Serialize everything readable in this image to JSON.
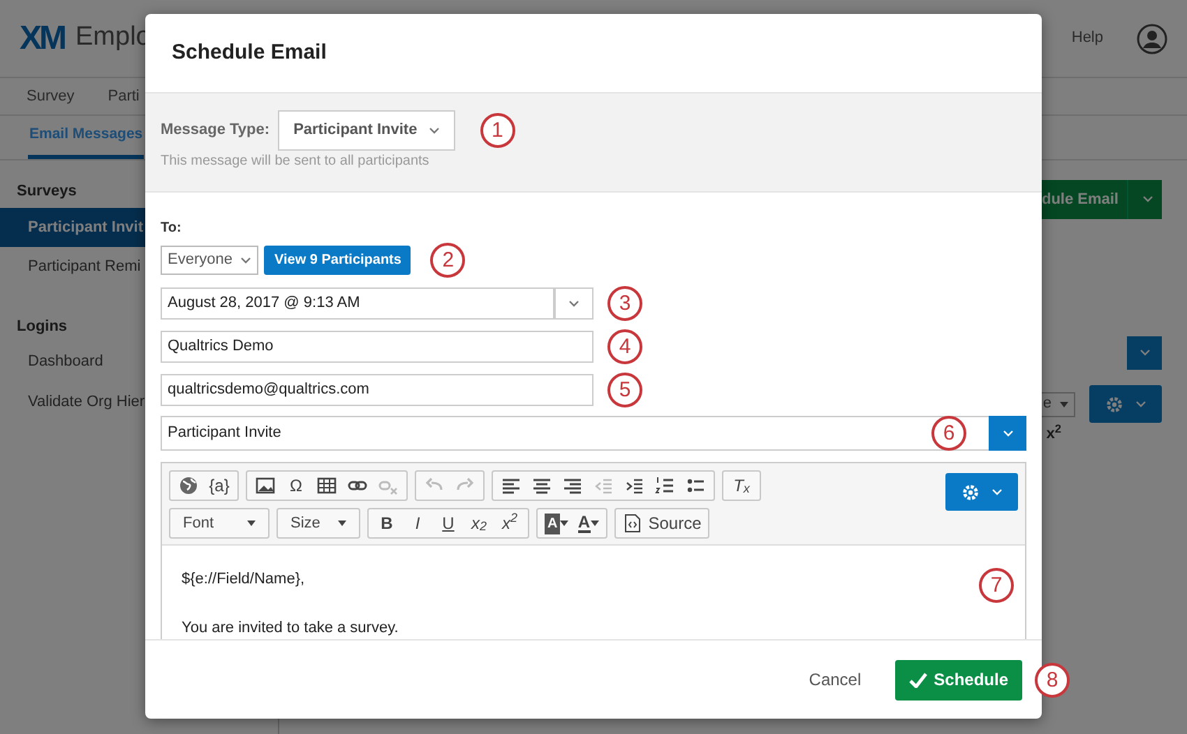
{
  "background": {
    "logo": "XM",
    "app_title": "Emplo",
    "help": "Help",
    "tabs": [
      {
        "label": "Survey",
        "selected": false
      },
      {
        "label": "Parti",
        "selected": false
      }
    ],
    "subtabs": [
      {
        "label": "Email Messages",
        "selected": true
      }
    ],
    "sidebar": [
      {
        "heading": "Surveys",
        "items": [
          {
            "label": "Participant Invit",
            "selected": true
          },
          {
            "label": "Participant Remi",
            "selected": false
          }
        ]
      },
      {
        "heading": "Logins",
        "items": [
          {
            "label": "Dashboard",
            "selected": false
          },
          {
            "label": "Validate Org Hier",
            "selected": false
          }
        ]
      }
    ],
    "schedule_button": "dule Email",
    "small_select": "e",
    "superscript": "x$^{2}$"
  },
  "dialog": {
    "title": "Schedule Email",
    "message_type": {
      "label": "Message Type:",
      "value": "Participant Invite",
      "hint": "This message will be sent to all participants"
    },
    "to": {
      "label": "To:",
      "select": "Everyone",
      "button": "View 9 Participants"
    },
    "send_date": "August 28, 2017 @ 9:13 AM",
    "from_name": "Qualtrics Demo",
    "reply_to": "qualtricsdemo@qualtrics.com",
    "message": "Participant Invite",
    "toolbar": {
      "rows": [
        [
          [
            {
              "kind": "globe"
            },
            {
              "kind": "text",
              "label": "{a}"
            }
          ],
          [
            {
              "kind": "image"
            },
            {
              "kind": "text",
              "label": "Ω"
            },
            {
              "kind": "table"
            },
            {
              "kind": "link"
            },
            {
              "kind": "unlink",
              "disabled": true
            }
          ],
          [
            {
              "kind": "undo",
              "disabled": true
            },
            {
              "kind": "redo",
              "disabled": true
            }
          ],
          [
            {
              "kind": "alignleft"
            },
            {
              "kind": "aligncenter"
            },
            {
              "kind": "alignright"
            },
            {
              "kind": "outdent",
              "disabled": true
            },
            {
              "kind": "indent"
            },
            {
              "kind": "numbered"
            },
            {
              "kind": "bulleted"
            }
          ],
          [
            {
              "kind": "rich",
              "label": "T$_{x}$"
            }
          ]
        ],
        [
          [
            {
              "kind": "dropdown",
              "label": "Font"
            }
          ],
          [
            {
              "kind": "dropdown",
              "label": "Size"
            }
          ],
          [
            {
              "kind": "bold",
              "label": "B"
            },
            {
              "kind": "italic",
              "label": "I"
            },
            {
              "kind": "underline",
              "label": "U"
            },
            {
              "kind": "rich",
              "label": "x$_{2}$"
            },
            {
              "kind": "rich",
              "label": "x$^{2}$"
            }
          ],
          [
            {
              "kind": "bgcolor",
              "label": "A"
            },
            {
              "kind": "textcolor",
              "label": "A"
            }
          ],
          [
            {
              "kind": "source",
              "label": "Source"
            }
          ]
        ]
      ]
    },
    "body": [
      "${e://Field/Name},",
      "You are invited to take a survey."
    ],
    "cancel": "Cancel",
    "schedule": "Schedule"
  },
  "callouts": [
    "1",
    "2",
    "3",
    "4",
    "5",
    "6",
    "7",
    "8"
  ]
}
